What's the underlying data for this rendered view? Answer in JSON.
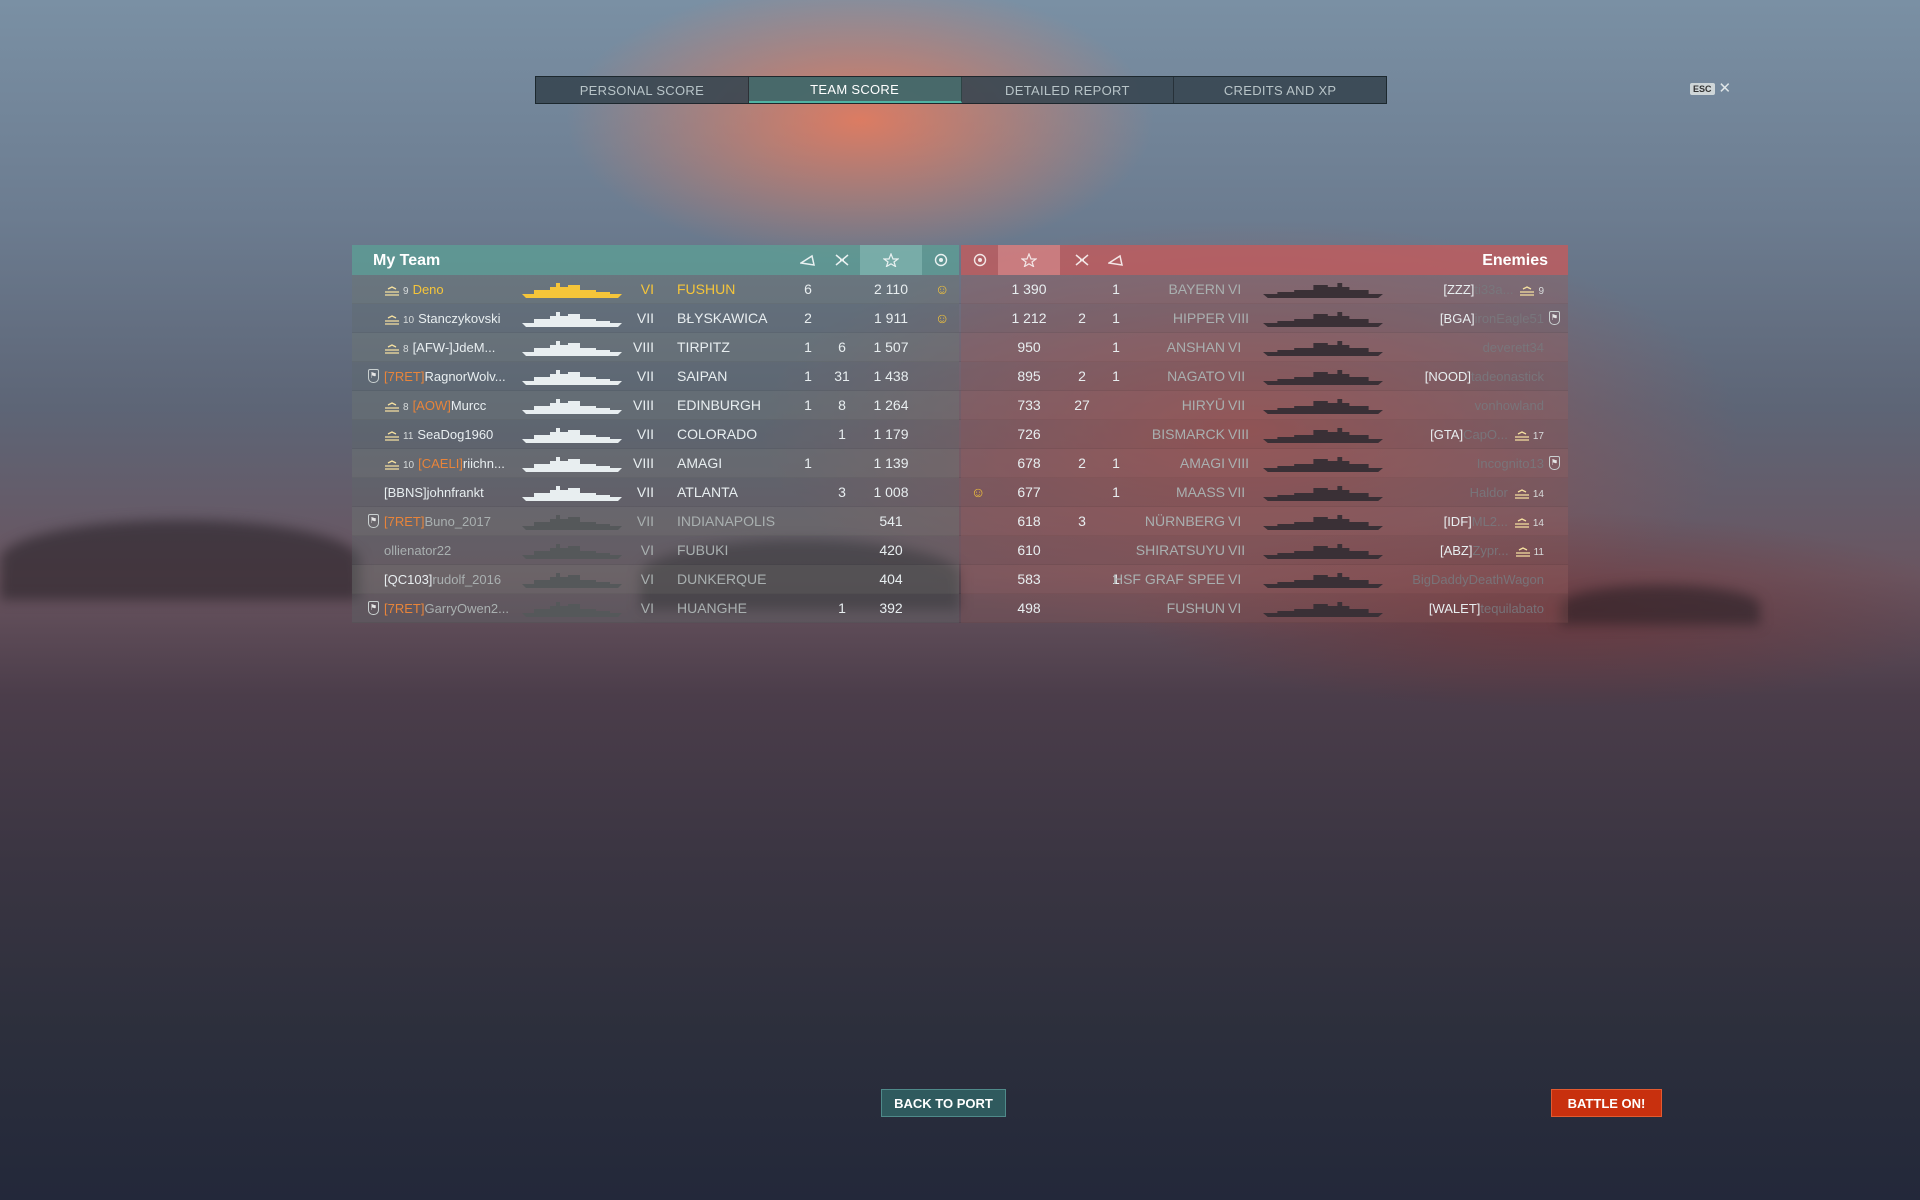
{
  "tabs": [
    "PERSONAL SCORE",
    "TEAM SCORE",
    "DETAILED REPORT",
    "CREDITS AND XP"
  ],
  "active_tab": "TEAM SCORE",
  "esc": {
    "key": "ESC",
    "close": "✕"
  },
  "my_team": {
    "title": "My Team",
    "rows": [
      {
        "rank": "9",
        "clan": "",
        "player": "Deno",
        "tier": "VI",
        "ship": "FUSHUN",
        "kills": "6",
        "planes": "",
        "xp": "2 110",
        "medal": true,
        "highlight": true
      },
      {
        "rank": "10",
        "clan": "",
        "player": "Stanczykovski",
        "tier": "VII",
        "ship": "BŁYSKAWICA",
        "kills": "2",
        "planes": "",
        "xp": "1 911",
        "medal": true
      },
      {
        "rank": "8",
        "clan": "[AFW-]",
        "player": "JdeM...",
        "tier": "VIII",
        "ship": "TIRPITZ",
        "kills": "1",
        "planes": "6",
        "xp": "1 507",
        "medal": false
      },
      {
        "rank": "",
        "clan": "[7RET]",
        "player": "RagnorWolv...",
        "tier": "VII",
        "ship": "SAIPAN",
        "kills": "1",
        "planes": "31",
        "xp": "1 438",
        "medal": false,
        "badge": true
      },
      {
        "rank": "8",
        "clan": "[AOW]",
        "player": "Murcc",
        "tier": "VIII",
        "ship": "EDINBURGH",
        "kills": "1",
        "planes": "8",
        "xp": "1 264",
        "medal": false
      },
      {
        "rank": "11",
        "clan": "",
        "player": "SeaDog1960",
        "tier": "VII",
        "ship": "COLORADO",
        "kills": "",
        "planes": "1",
        "xp": "1 179",
        "medal": false
      },
      {
        "rank": "10",
        "clan": "[CAELI]",
        "player": "riichn...",
        "tier": "VIII",
        "ship": "AMAGI",
        "kills": "1",
        "planes": "",
        "xp": "1 139",
        "medal": false
      },
      {
        "rank": "",
        "clan": "[BBNS]",
        "player": "johnfrankt",
        "tier": "VII",
        "ship": "ATLANTA",
        "kills": "",
        "planes": "3",
        "xp": "1 008",
        "medal": false
      },
      {
        "rank": "",
        "clan": "[7RET]",
        "player": "Buno_2017",
        "tier": "VII",
        "ship": "INDIANAPOLIS",
        "kills": "",
        "planes": "",
        "xp": "541",
        "medal": false,
        "badge": true,
        "dead": true
      },
      {
        "rank": "",
        "clan": "",
        "player": "ollienator22",
        "tier": "VI",
        "ship": "FUBUKI",
        "kills": "",
        "planes": "",
        "xp": "420",
        "medal": false,
        "dead": true
      },
      {
        "rank": "",
        "clan": "[QC103]",
        "player": "rudolf_2016",
        "tier": "VI",
        "ship": "DUNKERQUE",
        "kills": "",
        "planes": "",
        "xp": "404",
        "medal": false,
        "dead": true
      },
      {
        "rank": "",
        "clan": "[7RET]",
        "player": "GarryOwen2...",
        "tier": "VI",
        "ship": "HUANGHE",
        "kills": "",
        "planes": "1",
        "xp": "392",
        "medal": false,
        "badge": true,
        "dead": true
      }
    ]
  },
  "enemies": {
    "title": "Enemies",
    "rows": [
      {
        "xp": "1 390",
        "planes": "",
        "kills": "1",
        "ship": "BAYERN",
        "tier": "VI",
        "clan": "[ZZZ]",
        "player": "ti33a...",
        "rank": "9",
        "medal": false
      },
      {
        "xp": "1 212",
        "planes": "2",
        "kills": "1",
        "ship": "HIPPER",
        "tier": "VIII",
        "clan": "[BGA]",
        "player": "ironEagle51",
        "rank": "",
        "medal": false,
        "badge": true
      },
      {
        "xp": "950",
        "planes": "",
        "kills": "1",
        "ship": "ANSHAN",
        "tier": "VI",
        "clan": "",
        "player": "deverett34",
        "rank": "",
        "medal": false
      },
      {
        "xp": "895",
        "planes": "2",
        "kills": "1",
        "ship": "NAGATO",
        "tier": "VII",
        "clan": "[NOOD]",
        "player": "tadeonastick",
        "rank": "",
        "medal": false
      },
      {
        "xp": "733",
        "planes": "27",
        "kills": "",
        "ship": "HIRYŪ",
        "tier": "VII",
        "clan": "",
        "player": "vonhowland",
        "rank": "",
        "medal": false
      },
      {
        "xp": "726",
        "planes": "",
        "kills": "",
        "ship": "BISMARCK",
        "tier": "VIII",
        "clan": "[GTA]",
        "player": "CapO...",
        "rank": "17",
        "medal": false
      },
      {
        "xp": "678",
        "planes": "2",
        "kills": "1",
        "ship": "AMAGI",
        "tier": "VIII",
        "clan": "",
        "player": "Incognito13",
        "rank": "",
        "medal": false,
        "badge": true
      },
      {
        "xp": "677",
        "planes": "",
        "kills": "1",
        "ship": "MAASS",
        "tier": "VII",
        "clan": "",
        "player": "Haldor",
        "rank": "14",
        "medal": true
      },
      {
        "xp": "618",
        "planes": "3",
        "kills": "",
        "ship": "NÜRNBERG",
        "tier": "VI",
        "clan": "[IDF]",
        "player": "ML2...",
        "rank": "14",
        "medal": false
      },
      {
        "xp": "610",
        "planes": "",
        "kills": "",
        "ship": "SHIRATSUYU",
        "tier": "VII",
        "clan": "[ABZ]",
        "player": "Zypr...",
        "rank": "11",
        "medal": false
      },
      {
        "xp": "583",
        "planes": "",
        "kills": "1",
        "ship": "HSF GRAF SPEE",
        "tier": "VI",
        "clan": "",
        "player": "BigDaddyDeathWagon",
        "rank": "",
        "medal": false
      },
      {
        "xp": "498",
        "planes": "",
        "kills": "",
        "ship": "FUSHUN",
        "tier": "VI",
        "clan": "[WALET]",
        "player": "tequilabato",
        "rank": "",
        "medal": false
      }
    ]
  },
  "header_icons": [
    "ship-kill-icon",
    "plane-kill-icon",
    "star-icon",
    "medal-icon"
  ],
  "buttons": {
    "back": "BACK TO PORT",
    "battle": "BATTLE ON!"
  },
  "colors": {
    "my_team_header": "#5ca096",
    "enemy_header": "#c85a5a",
    "battle_button": "#c8300e",
    "highlight_player": "#f5c53a",
    "clan_orange": "#e8843a"
  }
}
